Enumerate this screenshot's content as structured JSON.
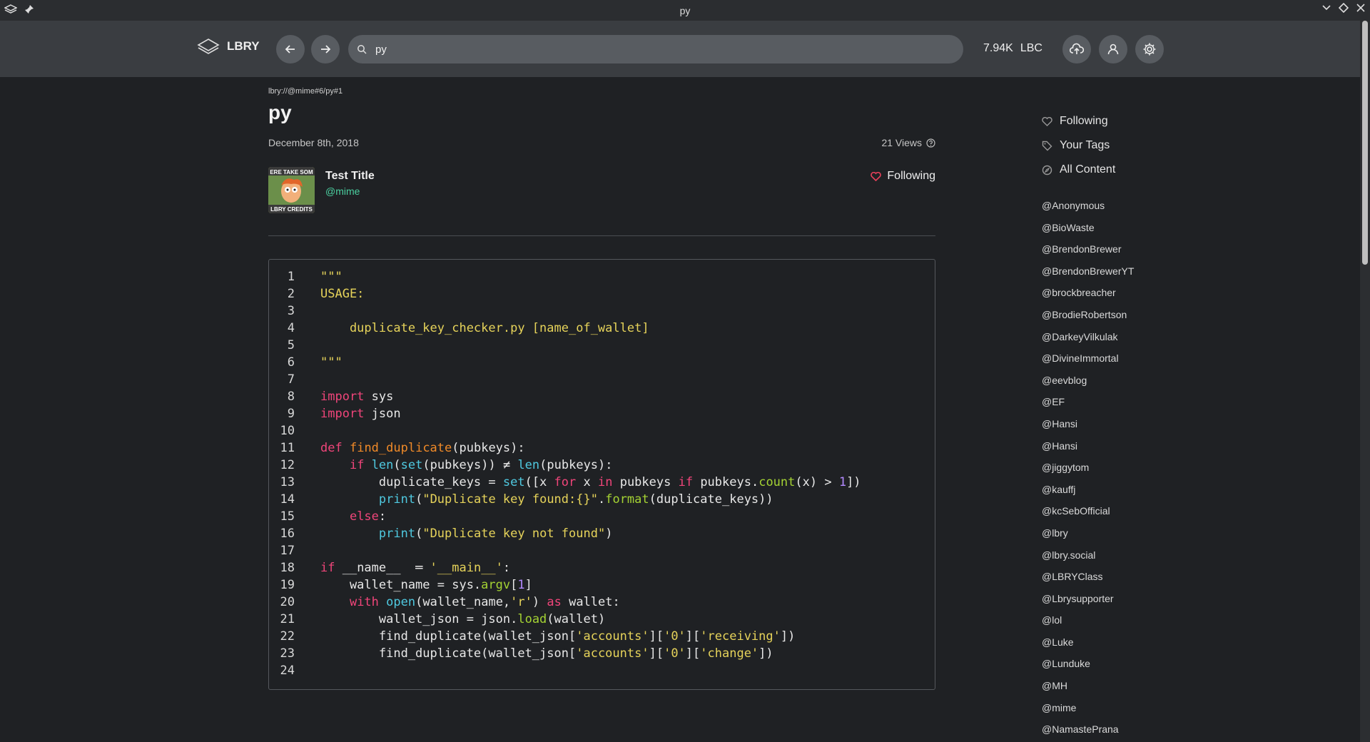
{
  "window": {
    "title": "py"
  },
  "header": {
    "logo_text": "LBRY",
    "search_value": "py",
    "balance_amount": "7.94K",
    "balance_unit": "LBC"
  },
  "page": {
    "uri": "lbry://@mime#6/py#1",
    "title": "py",
    "date": "December 8th, 2018",
    "views": "21 Views",
    "channel_title": "Test Title",
    "channel_handle": "@mime",
    "follow_label": "Following",
    "thumb_text_top": "ERE TAKE SOM",
    "thumb_text_bottom": "LBRY CREDITS"
  },
  "code_lines": [
    "1",
    "2",
    "3",
    "4",
    "5",
    "6",
    "7",
    "8",
    "9",
    "10",
    "11",
    "12",
    "13",
    "14",
    "15",
    "16",
    "17",
    "18",
    "19",
    "20",
    "21",
    "22",
    "23",
    "24"
  ],
  "code_text": {
    "l1": "\"\"\"",
    "l2": "USAGE:",
    "l4": "    duplicate_key_checker.py [name_of_wallet]",
    "l6": "\"\"\"",
    "l8_kw": "import",
    "l8_rest": " sys",
    "l9_kw": "import",
    "l9_rest": " json",
    "l11_kw": "def",
    "l11_fn": "find_duplicate",
    "l11_rest": "(pubkeys):",
    "l12_ind": "    ",
    "l12_kw": "if",
    "l12_a": " ",
    "l12_len": "len",
    "l12_b": "(",
    "l12_set": "set",
    "l12_c": "(pubkeys)) ≠ ",
    "l12_len2": "len",
    "l12_d": "(pubkeys):",
    "l13_a": "        duplicate_keys = ",
    "l13_set": "set",
    "l13_b": "([x ",
    "l13_for": "for",
    "l13_c": " x ",
    "l13_in": "in",
    "l13_d": " pubkeys ",
    "l13_if": "if",
    "l13_e": " pubkeys.",
    "l13_count": "count",
    "l13_f": "(x) > ",
    "l13_num": "1",
    "l13_g": "])",
    "l14_a": "        ",
    "l14_print": "print",
    "l14_b": "(",
    "l14_str": "\"Duplicate key found:{}\"",
    "l14_c": ".",
    "l14_fmt": "format",
    "l14_d": "(duplicate_keys))",
    "l15_a": "    ",
    "l15_kw": "else",
    "l15_b": ":",
    "l16_a": "        ",
    "l16_print": "print",
    "l16_b": "(",
    "l16_str": "\"Duplicate key not found\"",
    "l16_c": ")",
    "l18_kw": "if",
    "l18_a": " __name__  ═ ",
    "l18_str": "'__main__'",
    "l18_b": ":",
    "l19_a": "    wallet_name = sys.",
    "l19_argv": "argv",
    "l19_b": "[",
    "l19_num": "1",
    "l19_c": "]",
    "l20_a": "    ",
    "l20_with": "with",
    "l20_b": " ",
    "l20_open": "open",
    "l20_c": "(wallet_name,",
    "l20_str": "'r'",
    "l20_d": ") ",
    "l20_as": "as",
    "l20_e": " wallet:",
    "l21_a": "        wallet_json = json.",
    "l21_load": "load",
    "l21_b": "(wallet)",
    "l22_a": "        find_duplicate(wallet_json[",
    "l22_s1": "'accounts'",
    "l22_b": "][",
    "l22_s2": "'0'",
    "l22_c": "][",
    "l22_s3": "'receiving'",
    "l22_d": "])",
    "l23_a": "        find_duplicate(wallet_json[",
    "l23_s1": "'accounts'",
    "l23_b": "][",
    "l23_s2": "'0'",
    "l23_c": "][",
    "l23_s3": "'change'",
    "l23_d": "])"
  },
  "sidebar": {
    "nav": [
      "Following",
      "Your Tags",
      "All Content"
    ],
    "channels": [
      "@Anonymous",
      "@BioWaste",
      "@BrendonBrewer",
      "@BrendonBrewerYT",
      "@brockbreacher",
      "@BrodieRobertson",
      "@DarkeyVilkulak",
      "@DivineImmortal",
      "@eevblog",
      "@EF",
      "@Hansi",
      "@Hansi",
      "@jiggytom",
      "@kauffj",
      "@kcSebOfficial",
      "@lbry",
      "@lbry.social",
      "@LBRYClass",
      "@Lbrysupporter",
      "@lol",
      "@Luke",
      "@Lunduke",
      "@MH",
      "@mime",
      "@NamastePrana"
    ]
  },
  "colors": {
    "accent_green": "#4bd0a0",
    "heart": "#e8405a",
    "keyword": "#f0457a",
    "string": "#e6d35a"
  }
}
